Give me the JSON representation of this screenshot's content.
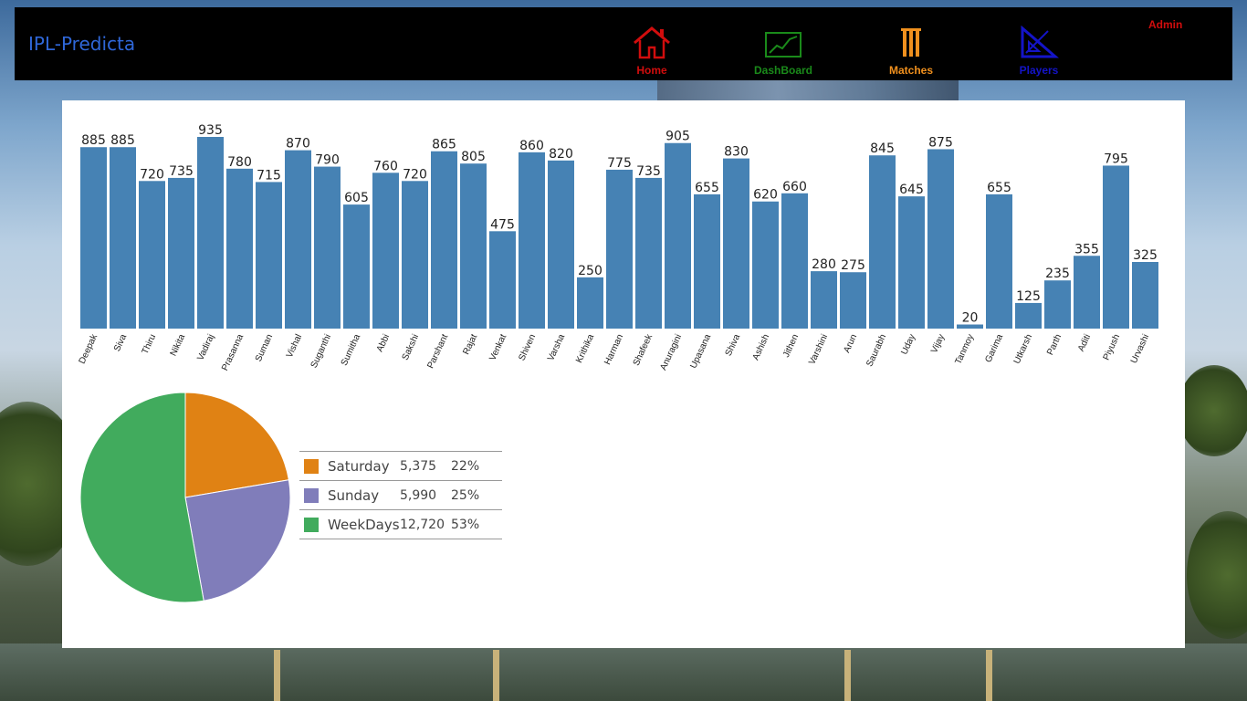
{
  "navbar": {
    "brand": "IPL-Predicta",
    "items": [
      {
        "label": "Home",
        "icon": "house-icon",
        "color": "#d10d0d"
      },
      {
        "label": "DashBoard",
        "icon": "line-chart-icon",
        "color": "#1a8a1a"
      },
      {
        "label": "Matches",
        "icon": "wicket-icon",
        "color": "#f0901e"
      },
      {
        "label": "Players",
        "icon": "set-square-icon",
        "color": "#1414c8"
      }
    ],
    "admin_label": "Admin"
  },
  "chart_data": [
    {
      "type": "bar",
      "color": "#4682b4",
      "categories": [
        "Deepak",
        "Siva",
        "Thiru",
        "Nikita",
        "Vadiraj",
        "Prasanna",
        "Suman",
        "Vishal",
        "Suganthi",
        "Sumitha",
        "Abbi",
        "Sakshi",
        "Parshant",
        "Rajat",
        "Venkat",
        "Shiven",
        "Varsha",
        "Krithika",
        "Harman",
        "Shafeek",
        "Anuragini",
        "Upasana",
        "Shiva",
        "Ashish",
        "Jithen",
        "Varshini",
        "Arun",
        "Saurabh",
        "Uday",
        "Vijay",
        "Tanmoy",
        "Garima",
        "Utkarsh",
        "Parth",
        "Aditi",
        "Piyush",
        "Urvashi"
      ],
      "values": [
        885,
        885,
        720,
        735,
        935,
        780,
        715,
        870,
        790,
        605,
        760,
        720,
        865,
        805,
        475,
        860,
        820,
        250,
        775,
        735,
        905,
        655,
        830,
        620,
        660,
        280,
        275,
        845,
        645,
        875,
        20,
        655,
        125,
        235,
        355,
        795,
        325
      ],
      "ylim": [
        0,
        935
      ]
    },
    {
      "type": "pie",
      "slices": [
        {
          "label": "Saturday",
          "value": 5375,
          "value_text": "5,375",
          "percent": "22%",
          "color": "#e08214"
        },
        {
          "label": "Sunday",
          "value": 5990,
          "value_text": "5,990",
          "percent": "25%",
          "color": "#807dba"
        },
        {
          "label": "WeekDays",
          "value": 12720,
          "value_text": "12,720",
          "percent": "53%",
          "color": "#41ab5d"
        }
      ]
    }
  ]
}
